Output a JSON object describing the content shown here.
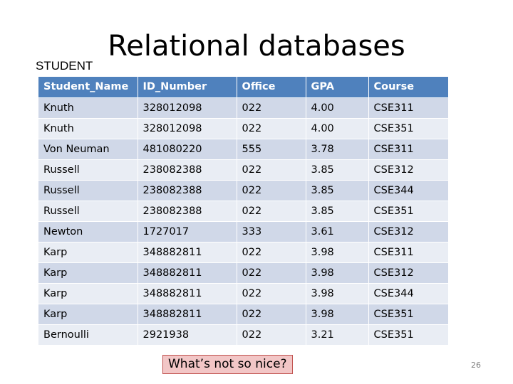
{
  "slide": {
    "title": "Relational databases",
    "table_label": "STUDENT",
    "question": "What’s not so nice?",
    "page_number": "26"
  },
  "table": {
    "headers": [
      "Student_Name",
      "ID_Number",
      "Office",
      "GPA",
      "Course"
    ],
    "rows": [
      [
        "Knuth",
        "328012098",
        "022",
        "4.00",
        "CSE311"
      ],
      [
        "Knuth",
        "328012098",
        "022",
        "4.00",
        "CSE351"
      ],
      [
        "Von Neuman",
        "481080220",
        "555",
        "3.78",
        "CSE311"
      ],
      [
        "Russell",
        "238082388",
        "022",
        "3.85",
        "CSE312"
      ],
      [
        "Russell",
        "238082388",
        "022",
        "3.85",
        "CSE344"
      ],
      [
        "Russell",
        "238082388",
        "022",
        "3.85",
        "CSE351"
      ],
      [
        "Newton",
        "1727017",
        "333",
        "3.61",
        "CSE312"
      ],
      [
        "Karp",
        "348882811",
        "022",
        "3.98",
        "CSE311"
      ],
      [
        "Karp",
        "348882811",
        "022",
        "3.98",
        "CSE312"
      ],
      [
        "Karp",
        "348882811",
        "022",
        "3.98",
        "CSE344"
      ],
      [
        "Karp",
        "348882811",
        "022",
        "3.98",
        "CSE351"
      ],
      [
        "Bernoulli",
        "2921938",
        "022",
        "3.21",
        "CSE351"
      ]
    ]
  },
  "colors": {
    "header_bg": "#4f81bd",
    "row_odd": "#d0d8e8",
    "row_even": "#e9edf4",
    "question_bg": "#f2c6c6",
    "question_border": "#c0504d"
  }
}
